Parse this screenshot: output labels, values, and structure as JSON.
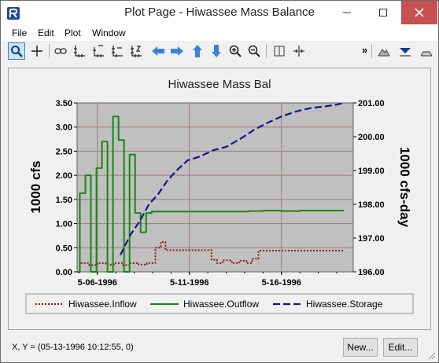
{
  "window": {
    "title": "Plot Page - Hiwassee Mass Balance"
  },
  "menu": {
    "items": [
      "File",
      "Edit",
      "Plot",
      "Window"
    ]
  },
  "toolbar": {
    "overflow_label": "»",
    "tools": [
      "zoom-icon",
      "crosshair-icon",
      "link-icon",
      "axis-icon",
      "axis-top-icon",
      "axis-left-icon",
      "axis-scale-icon",
      "scroll-left-icon",
      "scroll-right-icon",
      "scroll-up-icon",
      "scroll-down-icon",
      "zoom-in-icon",
      "zoom-out-icon",
      "split-vertical-icon",
      "split-horizontal-icon",
      "mountain-icon",
      "valley-icon",
      "flat-icon"
    ]
  },
  "statusbar": {
    "coords": "X, Y = (05-13-1996 10:12:55, 0)"
  },
  "buttons": {
    "new_label": "New...",
    "edit_label": "Edit..."
  },
  "chart_data": {
    "type": "line",
    "title": "Hiwassee Mass Bal",
    "ylabel": "1000 cfs",
    "y2label": "1000 cfs-day",
    "ylim": [
      0,
      3.5
    ],
    "y2lim": [
      196.0,
      201.0
    ],
    "yticks": [
      "0.00",
      "0.50",
      "1.00",
      "1.50",
      "2.00",
      "2.50",
      "3.00",
      "3.50"
    ],
    "y2ticks": [
      "196.00",
      "197.00",
      "198.00",
      "199.00",
      "200.00",
      "201.00"
    ],
    "xlim": [
      4.9,
      19.9
    ],
    "xticks": [
      {
        "value": 6,
        "label": "5-06-1996"
      },
      {
        "value": 11,
        "label": "5-11-1996"
      },
      {
        "value": 16,
        "label": "5-16-1996"
      }
    ],
    "grid": true,
    "legend_position": "bottom",
    "colors": {
      "inflow": "#8b1a1a",
      "outflow": "#128a12",
      "storage": "#14148c",
      "plot_bg": "#c0c0c0",
      "grid": "#a07878"
    },
    "series": [
      {
        "name": "Hiwassee.Inflow",
        "axis": "left",
        "style": "dotted",
        "step": true,
        "x": [
          5.1,
          5.55,
          6.0,
          6.45,
          6.9,
          7.35,
          7.8,
          8.25,
          8.7,
          9.15,
          9.45,
          9.7,
          12.2,
          12.5,
          12.8,
          13.3,
          13.7,
          14.1,
          14.4,
          14.75,
          19.4
        ],
        "values": [
          0.18,
          0.14,
          0.18,
          0.15,
          0.18,
          0.14,
          0.18,
          0.15,
          0.18,
          0.5,
          0.62,
          0.45,
          0.25,
          0.18,
          0.24,
          0.18,
          0.23,
          0.18,
          0.27,
          0.44,
          0.44
        ]
      },
      {
        "name": "Hiwassee.Outflow",
        "axis": "left",
        "style": "solid",
        "step": true,
        "x": [
          4.9,
          5.05,
          5.35,
          5.65,
          5.95,
          6.25,
          6.55,
          6.85,
          7.15,
          7.45,
          7.75,
          8.05,
          8.35,
          8.65,
          8.95,
          9.25,
          9.55,
          9.8,
          11.0,
          13.0,
          14.2,
          15.0,
          16.0,
          17.0,
          18.5,
          19.4
        ],
        "values": [
          0.0,
          1.63,
          2.0,
          0.0,
          2.15,
          2.7,
          0.0,
          3.22,
          2.73,
          0.0,
          2.43,
          1.22,
          0.82,
          1.22,
          1.25,
          1.25,
          1.25,
          1.25,
          1.25,
          1.25,
          1.26,
          1.27,
          1.26,
          1.27,
          1.27,
          1.27
        ]
      },
      {
        "name": "Hiwassee.Storage",
        "axis": "right",
        "style": "dashed",
        "step": false,
        "x": [
          7.25,
          7.8,
          8.3,
          8.8,
          9.3,
          9.8,
          10.3,
          10.9,
          11.5,
          12.3,
          13.0,
          13.8,
          14.5,
          15.2,
          16.0,
          16.8,
          17.6,
          18.4,
          19.0,
          19.4
        ],
        "values": [
          196.5,
          197.1,
          197.5,
          198.0,
          198.3,
          198.7,
          199.0,
          199.3,
          199.4,
          199.6,
          199.7,
          199.95,
          200.2,
          200.4,
          200.6,
          200.75,
          200.85,
          200.9,
          200.95,
          201.0
        ]
      }
    ]
  }
}
